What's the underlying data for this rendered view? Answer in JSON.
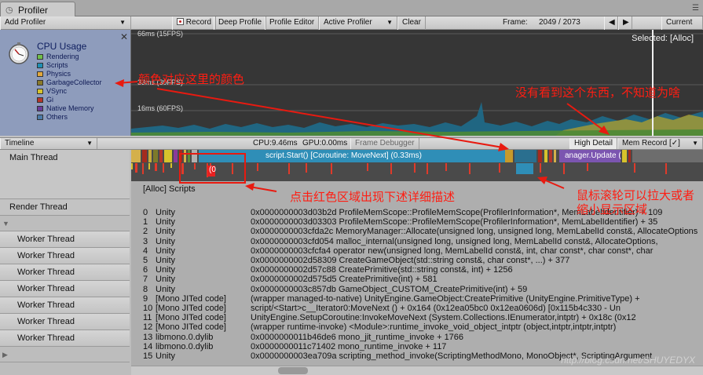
{
  "window": {
    "tab_title": "Profiler"
  },
  "toolbar": {
    "add_profiler": "Add Profiler",
    "record": "Record",
    "deep_profile": "Deep Profile",
    "profiler_editor": "Profile Editor",
    "active_profiler": "Active Profiler",
    "clear": "Clear",
    "frame_label": "Frame:",
    "frame_value": "2049 / 2073",
    "current": "Current"
  },
  "cpu": {
    "title": "CPU Usage",
    "legend": [
      {
        "label": "Rendering",
        "color": "#6fbf4b"
      },
      {
        "label": "Scripts",
        "color": "#1f8fb4"
      },
      {
        "label": "Physics",
        "color": "#e2a83d"
      },
      {
        "label": "GarbageCollector",
        "color": "#8a7a2a"
      },
      {
        "label": "VSync",
        "color": "#d6c22c"
      },
      {
        "label": "Gi",
        "color": "#b5352a"
      },
      {
        "label": "Native Memory",
        "color": "#6a3b9a"
      },
      {
        "label": "Others",
        "color": "#4b7aa7"
      }
    ],
    "lines": [
      "66ms (15FPS)",
      "33ms (30FPS)",
      "16ms (60FPS)"
    ],
    "selected": "Selected: [Alloc]"
  },
  "timeline_bar": {
    "mode": "Timeline",
    "cpu_time": "CPU:9.46ms",
    "gpu_time": "GPU:0.00ms",
    "frame_debugger": "Frame Debugger",
    "high_detail": "High Detail",
    "mem_record": "Mem Record [✓]"
  },
  "threads": {
    "main": "Main Thread",
    "render": "Render Thread",
    "worker": "Worker Thread"
  },
  "timeline": {
    "script_block": "script.Start() [Coroutine: MoveNext] (0.33ms)",
    "manager_block": "anager.Update (",
    "selected_marker": "(0"
  },
  "details": {
    "title": "[Alloc] Scripts",
    "rows": [
      {
        "i": "0",
        "m": "Unity",
        "d": "0x0000000003d03b2d ProfileMemScope::ProfileMemScope(ProfilerInformation*, MemLabelIdentifier) + 109"
      },
      {
        "i": "1",
        "m": "Unity",
        "d": "0x0000000003d03303 ProfileMemScope::ProfileMemScope(ProfilerInformation*, MemLabelIdentifier) + 35"
      },
      {
        "i": "2",
        "m": "Unity",
        "d": "0x0000000003cfda2c MemoryManager::Allocate(unsigned long, unsigned long, MemLabelId const&, AllocateOptions"
      },
      {
        "i": "3",
        "m": "Unity",
        "d": "0x0000000003cfd054 malloc_internal(unsigned long, unsigned long, MemLabelId const&, AllocateOptions,"
      },
      {
        "i": "4",
        "m": "Unity",
        "d": "0x0000000003cfcfa4 operator new(unsigned long, MemLabelId const&, int, char const*, char const*, char"
      },
      {
        "i": "5",
        "m": "Unity",
        "d": "0x0000000002d58309 CreateGameObject(std::string const&, char const*, ...) + 377"
      },
      {
        "i": "6",
        "m": "Unity",
        "d": "0x0000000002d57c88 CreatePrimitive(std::string const&, int) + 1256"
      },
      {
        "i": "7",
        "m": "Unity",
        "d": "0x0000000002d575d5 CreatePrimitive(int) + 581"
      },
      {
        "i": "8",
        "m": "Unity",
        "d": "0x0000000003c857db GameObject_CUSTOM_CreatePrimitive(int) + 59"
      },
      {
        "i": "9",
        "m": "[Mono JITed code]",
        "d": "       (wrapper managed-to-native) UnityEngine.GameObject:CreatePrimitive (UnityEngine.PrimitiveType) +"
      },
      {
        "i": "10",
        "m": "[Mono JITed code]",
        "d": "       script/<Start>c__Iterator0:MoveNext () + 0x164 (0x12ea05bc0 0x12ea0606d) [0x115b4c330 - Un"
      },
      {
        "i": "11",
        "m": "[Mono JITed code]",
        "d": "       UnityEngine.SetupCoroutine:InvokeMoveNext (System.Collections.IEnumerator,intptr) + 0x18c (0x12"
      },
      {
        "i": "12",
        "m": "[Mono JITed code]",
        "d": "       (wrapper runtime-invoke) <Module>:runtime_invoke_void_object_intptr (object,intptr,intptr,intptr)"
      },
      {
        "i": "13",
        "m": "libmono.0.dylib",
        "d": "0x0000000011b46de6 mono_jit_runtime_invoke + 1766"
      },
      {
        "i": "14",
        "m": "libmono.0.dylib",
        "d": "0x0000000011c71402 mono_runtime_invoke + 117"
      },
      {
        "i": "15",
        "m": "Unity",
        "d": "0x0000000003ea709a scripting_method_invoke(ScriptingMethodMono, MonoObject*, ScriptingArgument"
      }
    ]
  },
  "annotations": {
    "color_note": "颜色对应这里的颜色",
    "unknown_note": "没有看到这个东西，不知道为啥",
    "click_note": "点击红色区域出现下述详细描述",
    "scroll_note_1": "鼠标滚轮可以拉大或者",
    "scroll_note_2": "缩小显示区域"
  },
  "watermark": "http://blog.csdn.net/SHUYEDYX"
}
